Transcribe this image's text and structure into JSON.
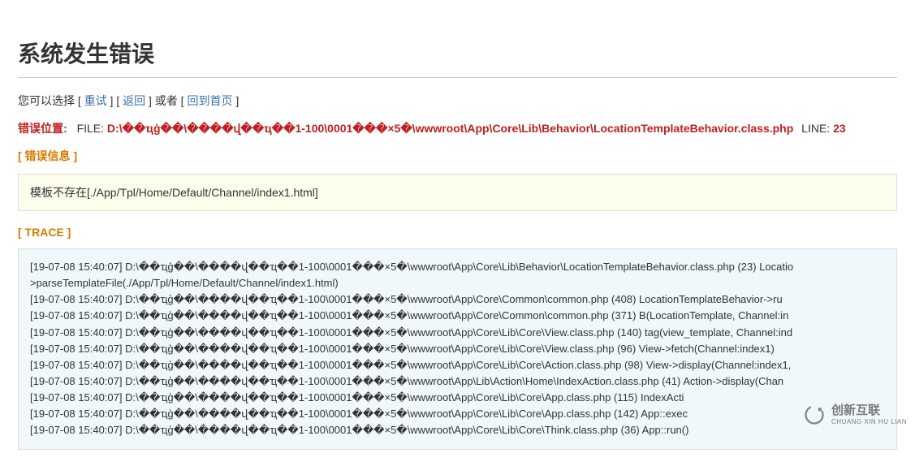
{
  "title": "系统发生错误",
  "actions": {
    "prefix": "您可以选择 [ ",
    "retry": "重试",
    "sep1": " ] [ ",
    "back": "返回",
    "sep2": " ] 或者 [ ",
    "home": "回到首页",
    "suffix": " ]"
  },
  "errorLocation": {
    "label": "错误位置:",
    "fileLabel": "FILE:",
    "path": "D:\\��ҵģ��\\����վ��ҵ��1-100\\0001���×5�\\wwwroot\\App\\Core\\Lib\\Behavior\\LocationTemplateBehavior.class.php",
    "lineLabel": "LINE:",
    "lineNum": "23"
  },
  "errorSection": {
    "header": "[ 错误信息 ]",
    "message": "模板不存在[./App/Tpl/Home/Default/Channel/index1.html]"
  },
  "traceSection": {
    "header": "[ TRACE ]",
    "lines": [
      "[19-07-08 15:40:07] D:\\��ҵģ��\\����վ��ҵ��1-100\\0001���×5�\\wwwroot\\App\\Core\\Lib\\Behavior\\LocationTemplateBehavior.class.php (23) Locatio",
      ">parseTemplateFile(./App/Tpl/Home/Default/Channel/index1.html)",
      "[19-07-08 15:40:07] D:\\��ҵģ��\\����վ��ҵ��1-100\\0001���×5�\\wwwroot\\App\\Core\\Common\\common.php (408) LocationTemplateBehavior->ru",
      "[19-07-08 15:40:07] D:\\��ҵģ��\\����վ��ҵ��1-100\\0001���×5�\\wwwroot\\App\\Core\\Common\\common.php (371) B(LocationTemplate, Channel:in",
      "[19-07-08 15:40:07] D:\\��ҵģ��\\����վ��ҵ��1-100\\0001���×5�\\wwwroot\\App\\Core\\Lib\\Core\\View.class.php (140) tag(view_template, Channel:ind",
      "[19-07-08 15:40:07] D:\\��ҵģ��\\����վ��ҵ��1-100\\0001���×5�\\wwwroot\\App\\Core\\Lib\\Core\\View.class.php (96) View->fetch(Channel:index1)",
      "[19-07-08 15:40:07] D:\\��ҵģ��\\����վ��ҵ��1-100\\0001���×5�\\wwwroot\\App\\Core\\Lib\\Core\\Action.class.php (98) View->display(Channel:index1,",
      "[19-07-08 15:40:07] D:\\��ҵģ��\\����վ��ҵ��1-100\\0001���×5�\\wwwroot\\App\\Lib\\Action\\Home\\IndexAction.class.php (41) Action->display(Chan",
      "[19-07-08 15:40:07] D:\\��ҵģ��\\����վ��ҵ��1-100\\0001���×5�\\wwwroot\\App\\Core\\Lib\\Core\\App.class.php (115) IndexActi",
      "[19-07-08 15:40:07] D:\\��ҵģ��\\����վ��ҵ��1-100\\0001���×5�\\wwwroot\\App\\Core\\Lib\\Core\\App.class.php (142) App::exec",
      "[19-07-08 15:40:07] D:\\��ҵģ��\\����վ��ҵ��1-100\\0001���×5�\\wwwroot\\App\\Core\\Lib\\Core\\Think.class.php (36) App::run()"
    ]
  },
  "watermark": {
    "cn": "创新互联",
    "en": "CHUANG XIN HU LIAN"
  }
}
